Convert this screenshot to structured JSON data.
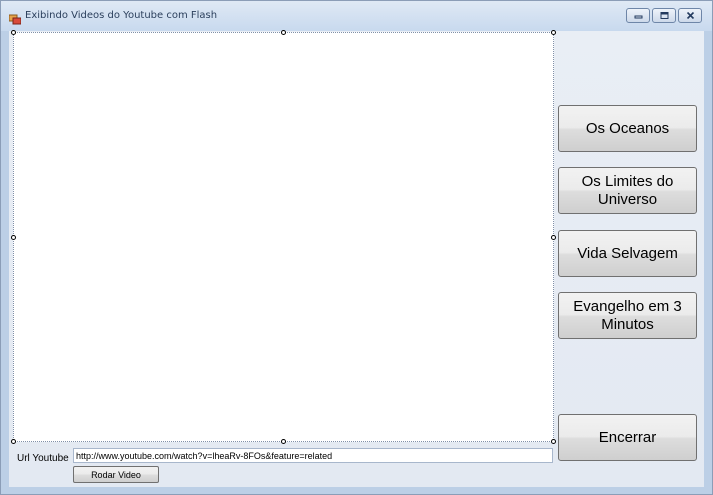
{
  "window": {
    "title": "Exibindo Videos do Youtube com Flash",
    "controls": [
      "minimize-icon",
      "maximize-icon",
      "close-icon"
    ]
  },
  "side_buttons": [
    {
      "label": "Os Oceanos"
    },
    {
      "label": "Os Limites do Universo"
    },
    {
      "label": "Vida Selvagem"
    },
    {
      "label": "Evangelho em 3 Minutos"
    },
    {
      "label": "Encerrar"
    }
  ],
  "url": {
    "label": "Url Youtube",
    "value": "http://www.youtube.com/watch?v=lheaRv-8FOs&feature=related"
  },
  "play_button": {
    "label": "Rodar Video"
  },
  "colors": {
    "window_bg": "#bccfe6",
    "client_bg": "#e9eef5",
    "button_border": "#707070"
  }
}
